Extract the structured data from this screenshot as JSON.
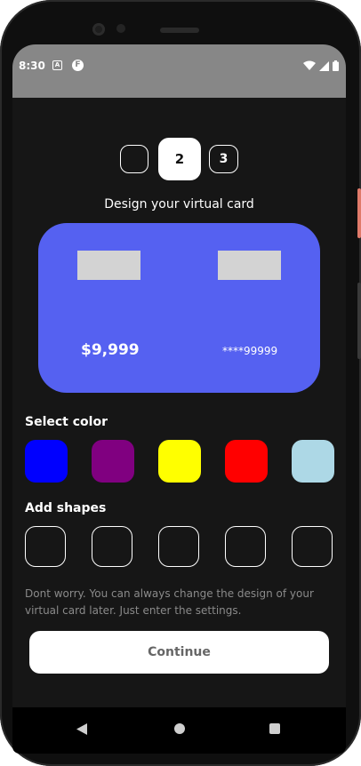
{
  "status_bar": {
    "time": "8:30",
    "icons": [
      "a-notification-icon",
      "f-notification-icon",
      "wifi-icon",
      "signal-icon",
      "battery-icon"
    ],
    "a_icon_letter": "A",
    "f_icon_letter": "F"
  },
  "stepper": {
    "steps": [
      "",
      "2",
      "3"
    ],
    "active_step": 2
  },
  "heading": "Design your virtual card",
  "card": {
    "color": "#5561f1",
    "balance": "$9,999",
    "number": "****99999"
  },
  "color_section": {
    "label": "Select color",
    "swatches": [
      {
        "name": "blue",
        "color": "#0000ff"
      },
      {
        "name": "purple",
        "color": "#800080"
      },
      {
        "name": "yellow",
        "color": "#ffff00"
      },
      {
        "name": "red",
        "color": "#ff0000"
      },
      {
        "name": "light-blue",
        "color": "#add8e6"
      }
    ]
  },
  "shapes_section": {
    "label": "Add shapes",
    "count": 5
  },
  "note": "Dont worry. You can always change the design of your virtual card later. Just enter the settings.",
  "continue_label": "Continue",
  "nav": {
    "icons": [
      "back-icon",
      "home-icon",
      "recents-icon"
    ]
  }
}
